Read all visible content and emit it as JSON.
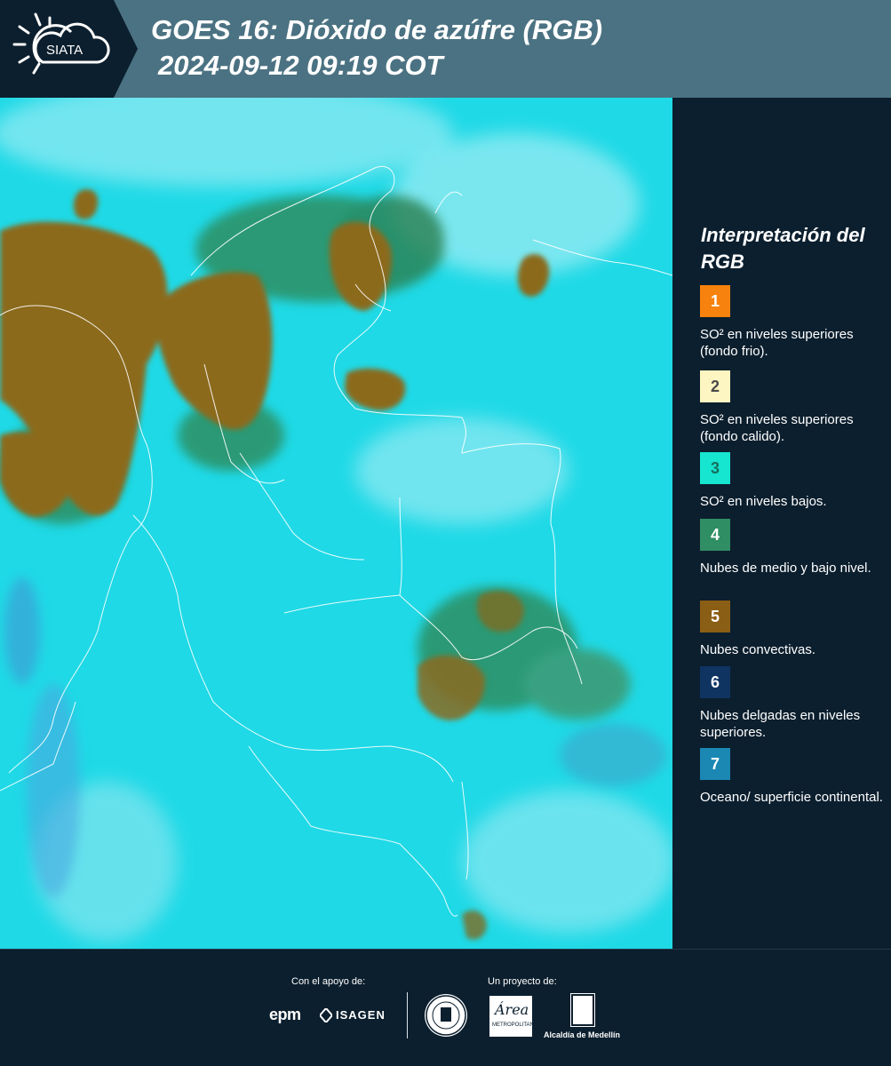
{
  "header": {
    "logo_text": "SIATA",
    "title_line1": "GOES 16: Dióxido de azúfre (RGB)",
    "title_line2": "2024-09-12 09:19 COT",
    "background_color": "#4b7282"
  },
  "map": {
    "base_color": "#1fd9e6",
    "convective_color": "#8b6a1e",
    "low_cloud_color": "#2e8a5a"
  },
  "legend": {
    "title": "Interpretación del RGB",
    "items": [
      {
        "number": "1",
        "text": "SO² en niveles superiores (fondo frio).",
        "color": "#f7820d",
        "number_color": "#ffffff"
      },
      {
        "number": "2",
        "text": "SO² en niveles superiores (fondo calido).",
        "color": "#fdf6c2",
        "number_color": "#4a4a4a"
      },
      {
        "number": "3",
        "text": "SO² en niveles bajos.",
        "color": "#16e5cf",
        "number_color": "#16705f"
      },
      {
        "number": "4",
        "text": "Nubes de medio y bajo nivel.",
        "color": "#2f8e63",
        "number_color": "#ffffff"
      },
      {
        "number": "5",
        "text": "Nubes convectivas.",
        "color": "#8b5e15",
        "number_color": "#ffffff"
      },
      {
        "number": "6",
        "text": "Nubes delgadas en niveles superiores.",
        "color": "#0f3462",
        "number_color": "#ffffff"
      },
      {
        "number": "7",
        "text": "Oceano/ superficie continental.",
        "color": "#1a88b3",
        "number_color": "#ffffff"
      }
    ]
  },
  "footer": {
    "support_caption": "Con el apoyo de:",
    "project_caption": "Un proyecto de:",
    "epm_label": "epm",
    "isagen_label": "ISAGEN",
    "area_label": "Área",
    "area_sub": "METROPOLITANA",
    "alcaldia_label": "Alcaldía de Medellín"
  }
}
